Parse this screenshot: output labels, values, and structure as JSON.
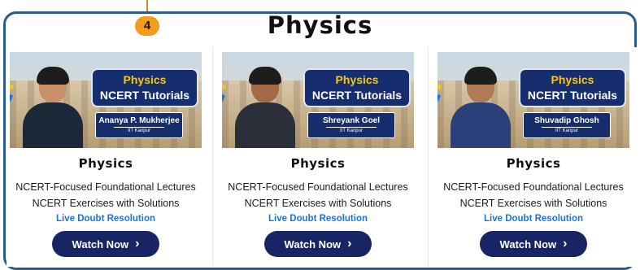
{
  "badge": "4",
  "page_title": "Physics",
  "icons": {
    "chevron": "chevron-right-icon"
  },
  "colors": {
    "accent": "#1e73d6",
    "button": "#172565",
    "badge": "#f39c1d",
    "frame": "#2a5a8a"
  },
  "cards": [
    {
      "banner_title": "Physics",
      "banner_subtitle": "NCERT Tutorials",
      "teacher": "Ananya P. Mukherjee",
      "institute": "IIT Kanpur",
      "subject": "Physics",
      "line1": "NCERT-Focused Foundational Lectures",
      "line2": "NCERT Exercises with Solutions",
      "line3": "Live Doubt Resolution",
      "cta": "Watch Now"
    },
    {
      "banner_title": "Physics",
      "banner_subtitle": "NCERT Tutorials",
      "teacher": "Shreyank Goel",
      "institute": "IIT Kanpur",
      "subject": "Physics",
      "line1": "NCERT-Focused Foundational Lectures",
      "line2": "NCERT Exercises with Solutions",
      "line3": "Live Doubt Resolution",
      "cta": "Watch Now"
    },
    {
      "banner_title": "Physics",
      "banner_subtitle": "NCERT Tutorials",
      "teacher": "Shuvadip Ghosh",
      "institute": "IIT Kanpur",
      "subject": "Physics",
      "line1": "NCERT-Focused Foundational Lectures",
      "line2": "NCERT Exercises with Solutions",
      "line3": "Live Doubt Resolution",
      "cta": "Watch Now"
    }
  ]
}
